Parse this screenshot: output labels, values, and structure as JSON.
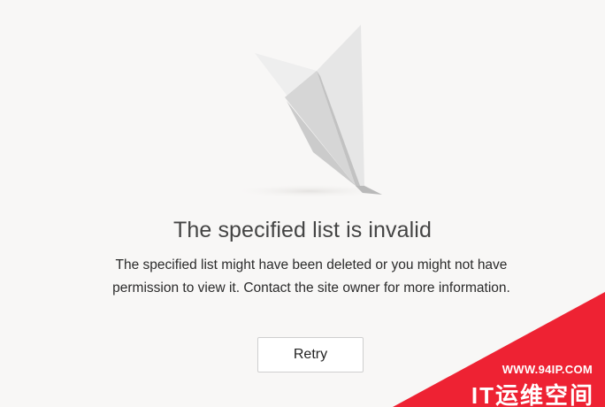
{
  "illustration": {
    "icon": "paper-airplane-icon"
  },
  "error": {
    "title": "The specified list is invalid",
    "message": "The specified list might have been deleted or you might not have permission to view it. Contact the site owner for more information."
  },
  "actions": {
    "retry_label": "Retry"
  },
  "watermark": {
    "url": "WWW.94IP.COM",
    "brand": "IT运维空间",
    "color": "#ee2233"
  },
  "colors": {
    "page_background": "#f8f7f6",
    "title_text": "#444444",
    "body_text": "#2b2b2b"
  }
}
